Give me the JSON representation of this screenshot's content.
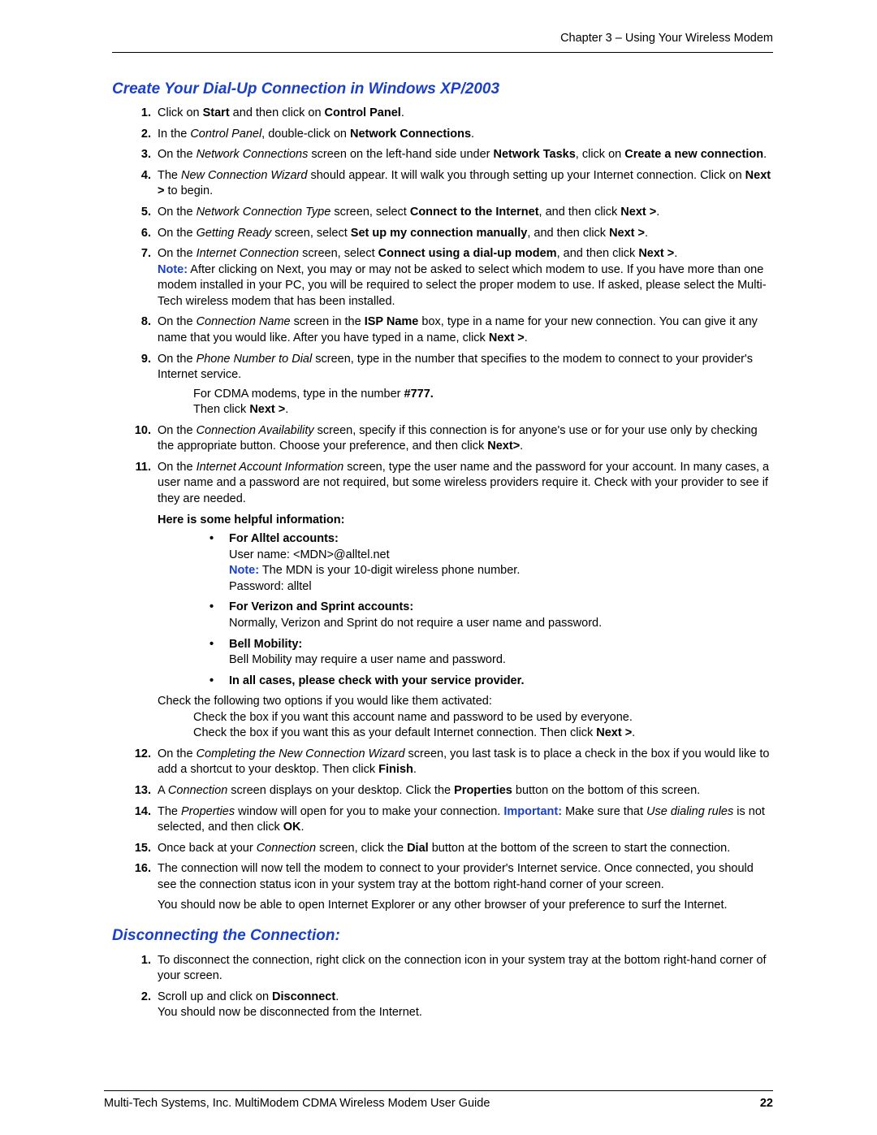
{
  "header": "Chapter 3 – Using Your Wireless Modem",
  "section1_title": "Create Your Dial-Up Connection in Windows XP/2003",
  "s1": {
    "i1": {
      "a": "Click on ",
      "b": "Start",
      "c": " and then click on ",
      "d": "Control Panel",
      "e": "."
    },
    "i2": {
      "a": "In the ",
      "b": "Control Panel",
      "c": ", double-click on ",
      "d": "Network Connections",
      "e": "."
    },
    "i3": {
      "a": "On the ",
      "b": "Network Connections",
      "c": " screen on the left-hand side under ",
      "d": "Network Tasks",
      "e": ", click on ",
      "f": "Create a new connection",
      "g": "."
    },
    "i4": {
      "a": "The ",
      "b": "New Connection Wizard",
      "c": " should appear. It will walk you through setting up your Internet connection. Click on ",
      "d": "Next >",
      "e": " to begin."
    },
    "i5": {
      "a": "On the ",
      "b": "Network Connection Type",
      "c": " screen, select ",
      "d": "Connect to the Internet",
      "e": ", and then click ",
      "f": "Next >",
      "g": "."
    },
    "i6": {
      "a": "On the ",
      "b": "Getting Ready",
      "c": " screen, select ",
      "d": "Set up my connection manually",
      "e": ", and then click ",
      "f": "Next >",
      "g": "."
    },
    "i7": {
      "a": "On the ",
      "b": "Internet Connection",
      "c": " screen, select ",
      "d": "Connect using a dial-up modem",
      "e": ", and then click ",
      "f": "Next >",
      "g": ".",
      "note_label": "Note:",
      "note": " After clicking on Next, you may or may not be asked to select which modem to use. If you have more than one modem installed in your PC, you will be required to select the proper modem to use. If asked, please select the Multi-Tech wireless modem that has been installed."
    },
    "i8": {
      "a": "On the ",
      "b": "Connection Name",
      "c": " screen in the ",
      "d": "ISP Name",
      "e": " box, type in a name for your new connection. You can give it any name that you would like. After you have typed in a name, click ",
      "f": "Next >",
      "g": "."
    },
    "i9": {
      "a": "On the ",
      "b": "Phone Number to Dial",
      "c": " screen, type in the number that specifies to the modem to connect to your provider's Internet service.",
      "sub1a": "For CDMA modems, type in the number ",
      "sub1b": "#777.",
      "sub2a": "Then click ",
      "sub2b": "Next >",
      "sub2c": "."
    },
    "i10": {
      "a": "On the ",
      "b": "Connection Availability",
      "c": " screen, specify if this connection is for anyone's use or for your use only by checking the appropriate button. Choose your preference, and then click ",
      "d": "Next>",
      "e": "."
    },
    "i11": {
      "a": "On the ",
      "b": "Internet Account Information",
      "c": " screen, type the user name and the password for your account. In many cases, a user name and a password are not required, but some wireless providers require it. Check with your provider to see if they are needed.",
      "helpful_heading": "Here is some helpful information:",
      "alltel_title": "For Alltel accounts:",
      "alltel_user": "User name: <MDN>@alltel.net",
      "alltel_note_label": "Note:",
      "alltel_note": " The MDN is your 10-digit wireless phone number.",
      "alltel_password": "Password: alltel",
      "verizon_title": "For Verizon and Sprint accounts:",
      "verizon_body": "Normally, Verizon and Sprint do not require a user name and password.",
      "bell_title": "Bell Mobility:",
      "bell_body": "Bell Mobility may require a user name and password.",
      "allcases": "In all cases, please check with your service provider.",
      "check_intro": "Check the following two options if you would like them activated:",
      "check1": "Check the box if you want this account name and password to be used by everyone.",
      "check2a": "Check the box if you want this as your default Internet connection. Then click ",
      "check2b": "Next >",
      "check2c": "."
    },
    "i12": {
      "a": "On the ",
      "b": "Completing the New Connection Wizard",
      "c": " screen, you last task is to place a check in the box if you would like to add a shortcut to your desktop. Then click ",
      "d": "Finish",
      "e": "."
    },
    "i13": {
      "a": "A ",
      "b": "Connection",
      "c": " screen displays on your desktop. Click the ",
      "d": "Properties",
      "e": " button on the bottom of this screen."
    },
    "i14": {
      "a": "The ",
      "b": "Properties",
      "c": " window will open for you to make your connection. ",
      "imp_label": "Important:",
      "d": " Make sure that ",
      "e": "Use dialing rules",
      "f": " is not selected, and then click ",
      "g": "OK",
      "h": "."
    },
    "i15": {
      "a": "Once back at your ",
      "b": "Connection",
      "c": " screen, click the ",
      "d": "Dial",
      "e": " button at the bottom of the screen to start the connection."
    },
    "i16": {
      "a": "The connection will now tell the modem to connect to your provider's Internet service. Once connected, you should see the connection status icon in your system tray at the bottom right-hand corner of your screen.",
      "p2": "You should now be able to open Internet Explorer or any other browser of your preference to surf the Internet."
    }
  },
  "section2_title": "Disconnecting the Connection:",
  "s2": {
    "i1": "To disconnect the connection, right click on the connection icon in your system tray at the bottom right-hand corner of your screen.",
    "i2": {
      "a": "Scroll up and click on ",
      "b": "Disconnect",
      "c": ".",
      "d": "You should now be disconnected from the Internet."
    }
  },
  "footer_left": "Multi-Tech Systems, Inc. MultiModem CDMA Wireless Modem User Guide",
  "footer_right": "22"
}
